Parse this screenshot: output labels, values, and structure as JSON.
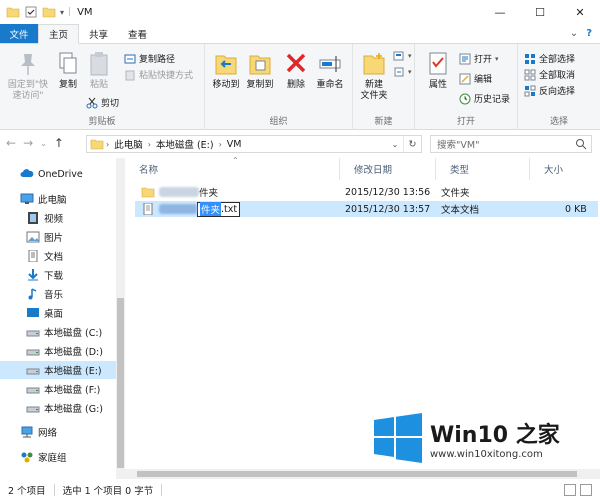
{
  "window": {
    "title": "VM",
    "controls": {
      "minimize": "—",
      "maximize": "☐",
      "close": "✕"
    }
  },
  "ribbon_tabs": {
    "file": "文件",
    "home": "主页",
    "share": "共享",
    "view": "查看",
    "help_glyph": "?",
    "expand_glyph": "⌄"
  },
  "clipboard": {
    "pin_quick_access": "固定到\"快\n速访问\"",
    "copy": "复制",
    "paste": "粘贴",
    "cut": "剪切",
    "copy_path": "复制路径",
    "paste_shortcut": "粘贴快捷方式",
    "group_label": "剪贴板"
  },
  "organize": {
    "move_to": "移动到",
    "copy_to": "复制到",
    "delete": "删除",
    "rename": "重命名",
    "group_label": "组织"
  },
  "new": {
    "new_folder": "新建\n文件夹",
    "group_label": "新建"
  },
  "open": {
    "properties": "属性",
    "open": "打开",
    "edit": "编辑",
    "history": "历史记录",
    "group_label": "打开"
  },
  "select": {
    "select_all": "全部选择",
    "select_none": "全部取消",
    "invert": "反向选择",
    "group_label": "选择"
  },
  "address": {
    "crumbs": [
      "此电脑",
      "本地磁盘 (E:)",
      "VM"
    ],
    "search_placeholder": "搜索\"VM\""
  },
  "nav_pane": {
    "items": [
      {
        "label": "OneDrive",
        "icon": "cloud-icon"
      },
      {
        "label": "此电脑",
        "icon": "computer-icon"
      },
      {
        "label": "视频",
        "icon": "video-icon"
      },
      {
        "label": "图片",
        "icon": "pictures-icon"
      },
      {
        "label": "文档",
        "icon": "documents-icon"
      },
      {
        "label": "下载",
        "icon": "download-icon"
      },
      {
        "label": "音乐",
        "icon": "music-icon"
      },
      {
        "label": "桌面",
        "icon": "desktop-icon"
      },
      {
        "label": "本地磁盘 (C:)",
        "icon": "drive-icon"
      },
      {
        "label": "本地磁盘 (D:)",
        "icon": "drive-icon"
      },
      {
        "label": "本地磁盘 (E:)",
        "icon": "drive-icon",
        "selected": true
      },
      {
        "label": "本地磁盘 (F:)",
        "icon": "drive-icon"
      },
      {
        "label": "本地磁盘 (G:)",
        "icon": "drive-icon"
      },
      {
        "label": "网络",
        "icon": "network-icon"
      },
      {
        "label": "家庭组",
        "icon": "homegroup-icon"
      }
    ]
  },
  "columns": {
    "name": "名称",
    "modified": "修改日期",
    "type": "类型",
    "size": "大小"
  },
  "files": [
    {
      "name_visible": "件夹",
      "modified": "2015/12/30 13:56",
      "type": "文件夹",
      "size": ""
    },
    {
      "name_selected": "件夹",
      "name_ext": ".txt",
      "modified": "2015/12/30 13:57",
      "type": "文本文档",
      "size": "0 KB"
    }
  ],
  "status_bar": {
    "item_count": "2 个项目",
    "selection": "选中 1 个项目  0 字节"
  },
  "watermark": {
    "brand": "Win10 之家",
    "url": "www.win10xitong.com"
  },
  "colors": {
    "accent": "#1979ca",
    "selection": "#cce8ff",
    "folder": "#f8d775",
    "win_logo": "#1e90e0"
  }
}
